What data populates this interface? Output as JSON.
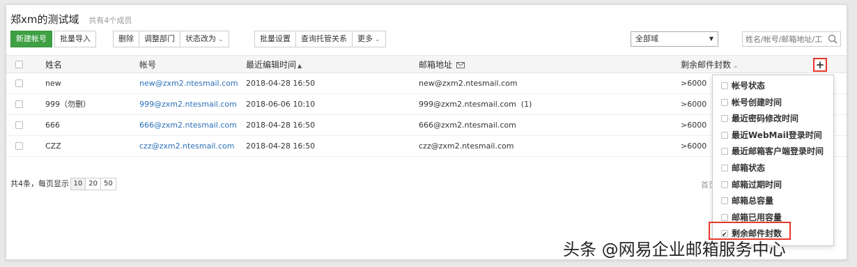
{
  "header": {
    "title": "郑xm的测试域",
    "subtitle": "共有4个成员"
  },
  "toolbar": {
    "new_account": "新建帐号",
    "batch_import": "批量导入",
    "delete": "删除",
    "adjust_dept": "调整部门",
    "change_status": "状态改为",
    "batch_settings": "批量设置",
    "query_trust": "查询托管关系",
    "more": "更多",
    "dept_select": "全部域",
    "search_placeholder": "姓名/帐号/邮箱地址/工号"
  },
  "table": {
    "columns": {
      "name": "姓名",
      "account": "帐号",
      "last_edit": "最近编辑时间",
      "email": "邮箱地址",
      "remaining": "剩余邮件封数"
    },
    "rows": [
      {
        "name": "new",
        "account": "new@zxm2.ntesmail.com",
        "last_edit": "2018-04-28 16:50",
        "email": "new@zxm2.ntesmail.com",
        "remaining": ">6000"
      },
      {
        "name": "999（勿删）",
        "account": "999@zxm2.ntesmail.com",
        "last_edit": "2018-06-06 10:10",
        "email": "999@zxm2.ntesmail.com  (1)",
        "remaining": ">6000"
      },
      {
        "name": "666",
        "account": "666@zxm2.ntesmail.com",
        "last_edit": "2018-04-28 16:50",
        "email": "666@zxm2.ntesmail.com",
        "remaining": ">6000"
      },
      {
        "name": "CZZ",
        "account": "czz@zxm2.ntesmail.com",
        "last_edit": "2018-04-28 16:50",
        "email": "czz@zxm2.ntesmail.com",
        "remaining": ">6000"
      }
    ]
  },
  "footer": {
    "total": "共4条，每页显示",
    "page_sizes": [
      "10",
      "20",
      "50"
    ],
    "first_page": "首页"
  },
  "column_menu": {
    "items": [
      {
        "label": "帐号状态",
        "checked": false
      },
      {
        "label": "帐号创建时间",
        "checked": false
      },
      {
        "label": "最近密码修改时间",
        "checked": false
      },
      {
        "label": "最近WebMail登录时间",
        "checked": false
      },
      {
        "label": "最近邮箱客户端登录时间",
        "checked": false
      },
      {
        "label": "邮箱状态",
        "checked": false
      },
      {
        "label": "邮箱过期时间",
        "checked": false
      },
      {
        "label": "邮箱总容量",
        "checked": false
      },
      {
        "label": "邮箱已用容量",
        "checked": false
      },
      {
        "label": "剩余邮件封数",
        "checked": true
      }
    ]
  },
  "watermark": "头条 @网易企业邮箱服务中心",
  "colors": {
    "primary_green": "#3ea043",
    "link_blue": "#2a6fb8",
    "highlight_red": "#e8372c"
  }
}
